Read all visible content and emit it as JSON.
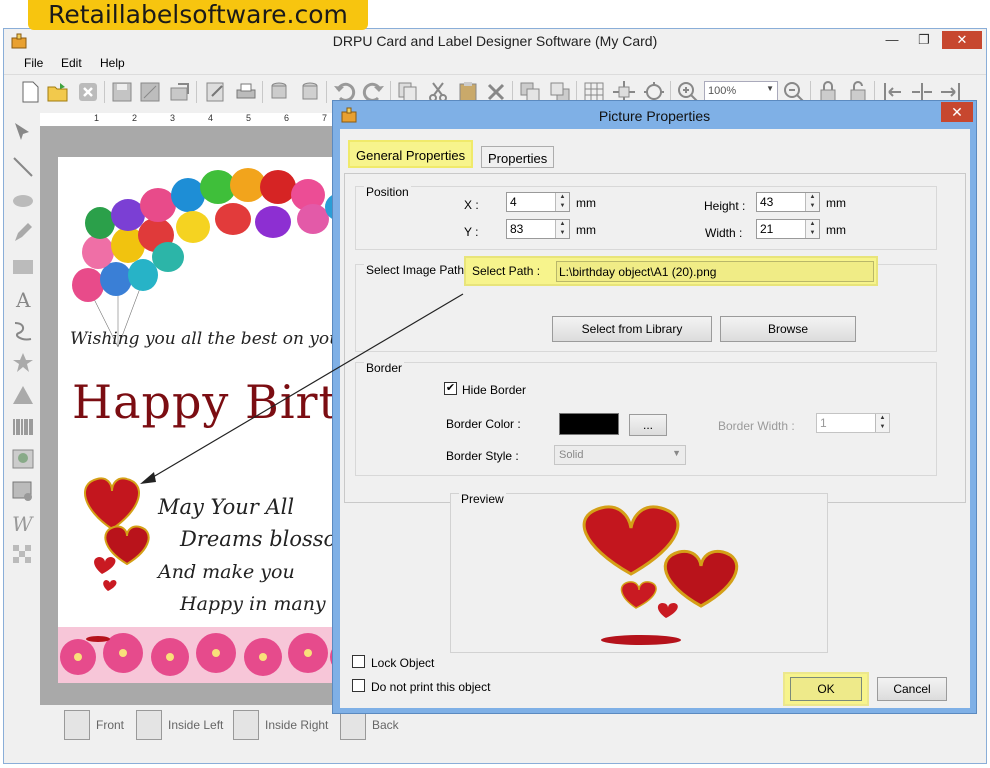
{
  "banner": {
    "text": "Retaillabelsoftware.com"
  },
  "app": {
    "title": "DRPU Card and Label Designer Software  (My Card)",
    "menu": [
      "File",
      "Edit",
      "Help"
    ],
    "zoom": "100%"
  },
  "ruler": {
    "ticks": [
      "1",
      "2",
      "3",
      "4",
      "5",
      "6",
      "7"
    ]
  },
  "card": {
    "line_wish": "Wishing you all the best on you",
    "happy": "Happy Birt",
    "line_1": "May Your All",
    "line_2": "Dreams blosso",
    "line_3": "And make you",
    "line_4": "Happy in many"
  },
  "page_tabs": {
    "front": "Front",
    "inside_left": "Inside Left",
    "inside_right": "Inside Right",
    "back": "Back"
  },
  "dialog": {
    "title": "Picture Properties",
    "tabs": {
      "general": "General Properties",
      "properties": "Properties"
    },
    "position": {
      "title": "Position",
      "x_label": "X :",
      "x_value": "4",
      "x_unit": "mm",
      "y_label": "Y :",
      "y_value": "83",
      "y_unit": "mm",
      "height_label": "Height :",
      "height_value": "43",
      "height_unit": "mm",
      "width_label": "Width :",
      "width_value": "21",
      "width_unit": "mm"
    },
    "image_path": {
      "title": "Select Image Path",
      "label": "Select Path :",
      "value": "L:\\birthday object\\A1 (20).png",
      "library_button": "Select from Library",
      "browse_button": "Browse"
    },
    "border": {
      "title": "Border",
      "hide_label": "Hide Border",
      "hide_checked": true,
      "color_label": "Border Color :",
      "color_button": "...",
      "color_value": "#000000",
      "width_label": "Border Width :",
      "width_value": "1",
      "style_label": "Border Style :",
      "style_value": "Solid"
    },
    "preview_label": "Preview",
    "lock_label": "Lock Object",
    "noprint_label": "Do not print this object",
    "ok": "OK",
    "cancel": "Cancel"
  }
}
